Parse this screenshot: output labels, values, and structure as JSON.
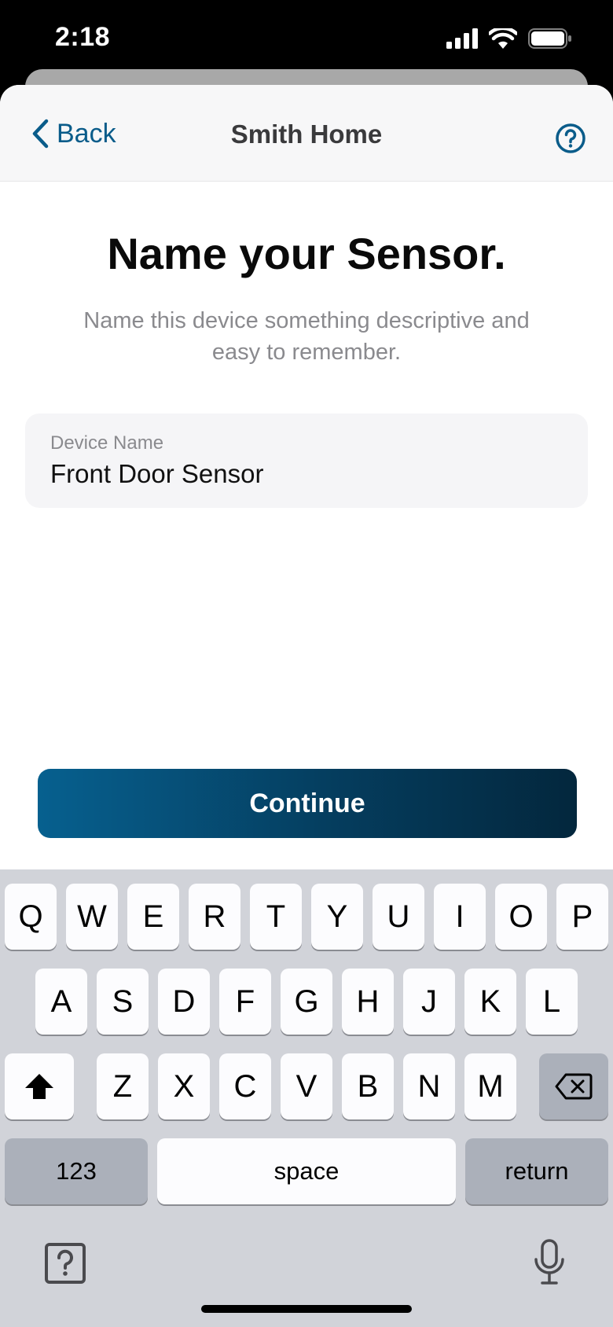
{
  "status_bar": {
    "time": "2:18",
    "icons": [
      "signal-icon",
      "wifi-icon",
      "battery-icon"
    ]
  },
  "navbar": {
    "back_label": "Back",
    "title": "Smith Home",
    "help_icon": "question-circle-icon"
  },
  "content": {
    "heading": "Name your Sensor.",
    "subtext": "Name this device something descriptive and easy to remember.",
    "field": {
      "label": "Device Name",
      "value": "Front Door Sensor"
    },
    "continue_label": "Continue"
  },
  "keyboard": {
    "row1": [
      "Q",
      "W",
      "E",
      "R",
      "T",
      "Y",
      "U",
      "I",
      "O",
      "P"
    ],
    "row2": [
      "A",
      "S",
      "D",
      "F",
      "G",
      "H",
      "J",
      "K",
      "L"
    ],
    "row3": [
      "Z",
      "X",
      "C",
      "V",
      "B",
      "N",
      "M"
    ],
    "numbers_label": "123",
    "space_label": "space",
    "return_label": "return",
    "icons": [
      "shift-icon",
      "backspace-icon",
      "keyboard-help-icon",
      "microphone-icon"
    ]
  },
  "colors": {
    "accent": "#0a5c8a",
    "button_gradient_start": "#06608f",
    "button_gradient_end": "#03273d"
  }
}
